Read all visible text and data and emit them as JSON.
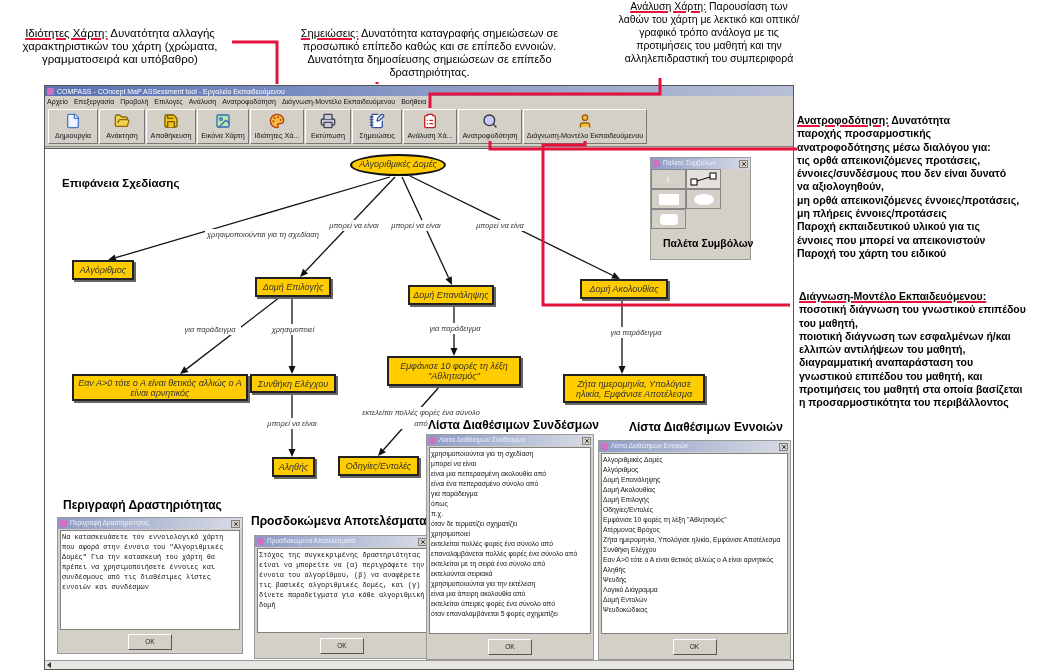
{
  "annotations_top": [
    {
      "heading": "Ιδιότητες Χάρτη:",
      "text": "Δυνατότητα αλλαγής χαρακτηριστικών του χάρτη (χρώματα, γραμματοσειρά και υπόβαθρο)"
    },
    {
      "heading": "Σημειώσεις:",
      "text": "Δυνατότητα καταγραφής σημειώσεων σε προσωπικό επίπεδο καθώς και σε επίπεδο εννοιών. Δυνατότητα δημοσίευσης σημειώσεων σε επίπεδο δραστηριότητας."
    },
    {
      "heading": "Ανάλυση Χάρτη:",
      "text": "Παρουσίαση των λαθών του χάρτη με λεκτικό και οπτικό/γραφικό τρόπο ανάλογα με τις προτιμήσεις του μαθητή και την αλληλεπιδραστική του συμπεριφορά"
    }
  ],
  "annotations_side": [
    {
      "heading": "Ανατροφοδότηση:",
      "heading_inline": true,
      "lines": [
        "Δυνατότητα",
        "παροχής προσαρμοστικής",
        "ανατροφοδότησης μέσω διαλόγου για:",
        "τις ορθά απεικονιζόμενες προτάσεις,",
        "έννοιες/συνδέσμους που δεν είναι δυνατό",
        "να αξιολογηθούν,",
        "μη ορθά απεικονιζόμενες έννοιες/προτάσεις,",
        "μη πλήρεις έννοιες/προτάσεις",
        "Παροχή εκπαιδευτικού υλικού για τις",
        "έννοιες που μπορεί να απεικονιστούν",
        "Παροχή του χάρτη του ειδικού"
      ]
    },
    {
      "heading": "Διάγνωση-Μοντέλο Εκπαιδευόμενου:",
      "heading_inline": false,
      "lines": [
        "ποσοτική διάγνωση του γνωστικού επιπέδου",
        "του μαθητή,",
        "ποιοτική διάγνωση των εσφαλμένων ή/και",
        "ελλιπών αντιλήψεων του μαθητή,",
        "διαγραμματική αναπαράσταση του",
        "γνωστικού επιπέδου του μαθητή, και",
        "προτιμήσεις του μαθητή στα οποία βασίζεται",
        "η προσαρμοστικότητα του περιβάλλοντος"
      ]
    }
  ],
  "window": {
    "title": "COMPASS - COncept MaP ASSessment tool - Εργαλείο Εκπαιδευόμενου",
    "menu": [
      "Αρχείο",
      "Επεξεργασία",
      "Προβολή",
      "Επιλογές",
      "Ανάλυση",
      "Ανατροφοδότηση",
      "Διάγνωση-Μοντέλο Εκπαιδευόμενου",
      "Βοήθεια"
    ],
    "toolbar": [
      "Δημιουργία",
      "Ανάκτηση",
      "Αποθήκευση",
      "Εικόνα Χάρτη",
      "Ιδιότητες Χά...",
      "Εκτύπωση",
      "Σημειώσεις",
      "Ανάλυση Χά...",
      "Ανατροφοδότηση",
      "Διάγνωση-Μοντέλο Εκπαιδευόμενου"
    ]
  },
  "canvas": {
    "label": "Επιφάνεια Σχεδίασης",
    "nodes": [
      {
        "kind": "ellipse",
        "text": "Αλγοριθμικές Δομές"
      },
      {
        "kind": "box",
        "text": "Αλγόριθμος"
      },
      {
        "kind": "box",
        "text": "Δομή Επιλογής"
      },
      {
        "kind": "box",
        "text": "Δομή Επανάληψης"
      },
      {
        "kind": "box",
        "text": "Δομή Ακολουθίας"
      },
      {
        "kind": "box",
        "text": "Εαν Α>0 τότε ο Α είναι θετικός αλλιώς ο Α είναι αρνητικός"
      },
      {
        "kind": "box",
        "text": "Συνθήκη Ελέγχου"
      },
      {
        "kind": "box",
        "text": "Εμφάνισε 10 φορές τη λέξη \"Αθλητισμός\""
      },
      {
        "kind": "box",
        "text": "Ζήτα ημερομηνία, Υπολόγισε ηλικία, Εμφάνισε Αποτέλεσμα"
      },
      {
        "kind": "box",
        "text": "Αληθής"
      },
      {
        "kind": "box",
        "text": "Οδηγίες/Εντολές"
      }
    ],
    "links": [
      "χρησιμοποιούνται για τη σχεδίαση",
      "μπορεί να είναι",
      "μπορεί να είναι",
      "μπορεί να είνα",
      "για παράδειγμα",
      "χρησιμοποιεί",
      "για παράδειγμα",
      "για παράδειγμα",
      "μπορεί να είναι",
      "εκτελείται πολλές φορές ένα σύνολο από"
    ]
  },
  "palette": {
    "title": "Παλέτα Συμβόλων",
    "caption": "Παλέτα Συμβόλων"
  },
  "dialogs": [
    {
      "kind": "text",
      "caption": "Περιγραφή Δραστηριότητας",
      "title": "Περιγραφή Δραστηριότητας",
      "text": "Να κατασκευάσετε τον εννοιολογικό χάρτη που αφορά στην έννοια του \"Αλγοριθμικές Δομές\" Για την κατασκευή του χάρτη θα πρέπει να χρησιμοποιήσετε έννοιες και συνδέσμους από τις διαθέσιμες λίστες εννοιών και συνδέσμων",
      "button": "OK"
    },
    {
      "kind": "text",
      "caption": "Προσδοκώμενα Αποτελέσματα",
      "title": "Προσδοκώμενα Αποτελέσματα",
      "text": "Στόχος της συγκεκριμένης δραστηριότητας είναι να μπορείτε να (α) περιγράφετε την έννοια του αλγορίθμου, (β) να αναφέρετε τις βασικές αλγοριθμικές δομές, και (γ) δίνετε παραδείγματα για κάθε αλγοριθμική δομή",
      "button": "OK"
    },
    {
      "kind": "list",
      "caption": "Λίστα Διαθέσιμων Συνδέσμων",
      "title": "Λίστα Διαθέσιμων Συνδέσμων",
      "items": [
        "χρησιμοποιούνται για τη σχεδίαση",
        "μπορεί να είναι",
        "είναι μια πεπερασμένη ακολουθία από",
        "είναι ένα πεπερασμένο σύνολο από",
        "για παράδειγμα",
        "όπως",
        "π.χ.",
        "όταν δε τερματίζει σχηματίζει",
        "χρησιμοποιεί",
        "εκτελείται πολλές φορές ένα σύνολο από",
        "επαναλαμβάνεται πολλές φορές ένα σύνολο από",
        "εκτελείται με τη σειρά ένα σύνολο από",
        "εκτελούνται σειριακά",
        "χρησιμοποιούνται για την εκτέλεση",
        "είναι μια άπειρη ακολουθία από",
        "εκτελείται άπειρες φορές ένα σύνολο από",
        "όταν επαναλαμβάνεται 5 φορές σχηματίζει"
      ],
      "button": "OK"
    },
    {
      "kind": "list",
      "caption": "Λίστα Διαθέσιμων Εννοιών",
      "title": "Λίστα Διαθέσιμων Εννοιών",
      "items": [
        "Αλγοριθμικές Δομές",
        "Αλγόριθμος",
        "Δομή Επανάληψης",
        "Δομή Ακολουθίας",
        "Δομή Επιλογής",
        "Οδηγίες/Εντολές",
        "Εμφάνισε 10 φορές τη λέξη \"Αθλητισμός\"",
        "Ατέρμονας Βρόχος",
        "Ζήτα ημερομηνία, Υπολόγισε ηλικία, Εμφάνισε Αποτέλεσμα",
        "Συνθήκη Ελέγχου",
        "Εαν Α>0 τότε ο Α είναι θετικός αλλιώς ο Α είναι αρνητικός",
        "Αληθής",
        "Ψευδής",
        "Λογικό Διάγραμμα",
        "Δομή Εντολών",
        "Ψευδοκώδικας"
      ],
      "button": "OK"
    }
  ]
}
